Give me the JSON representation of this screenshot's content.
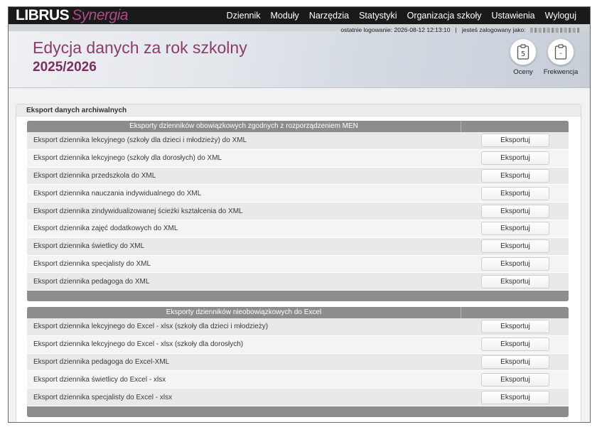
{
  "logo": {
    "part1": "LIBRUS",
    "part2": "Synergia"
  },
  "nav": [
    "Dziennik",
    "Moduły",
    "Narzędzia",
    "Statystyki",
    "Organizacja szkoły",
    "Ustawienia",
    "Wyloguj"
  ],
  "header": {
    "last_login": "ostatnie logowanie: 2026-08-12 12:13:10",
    "separator": "|",
    "logged_as": "jesteś zalogowany jako:",
    "title": "Edycja danych za rok szkolny",
    "year": "2025/2026"
  },
  "quick": [
    {
      "label": "Oceny",
      "icon": "grade-clipboard-icon",
      "glyph": "5"
    },
    {
      "label": "Frekwencja",
      "icon": "attendance-clipboard-icon",
      "glyph": "-"
    }
  ],
  "panel_title": "Eksport danych archiwalnych",
  "tables": [
    {
      "header": "Eksporty dzienników obowiązkowych zgodnych z rozporządzeniem MEN",
      "rows": [
        "Eksport dziennika lekcyjnego (szkoły dla dzieci i młodzieży) do XML",
        "Eksport dziennika lekcyjnego (szkoły dla dorosłych) do XML",
        "Eksport dziennika przedszkola do XML",
        "Eksport dziennika nauczania indywidualnego do XML",
        "Eksport dziennika zindywidualizowanej ścieżki kształcenia do XML",
        "Eksport dziennika zajęć dodatkowych do XML",
        "Eksport dziennika świetlicy do XML",
        "Eksport dziennika specjalisty do XML",
        "Eksport dziennika pedagoga do XML"
      ]
    },
    {
      "header": "Eksporty dzienników nieobowiązkowych do Excel",
      "rows": [
        "Eksport dziennika lekcyjnego do Excel - xlsx (szkoły dla dzieci i młodzieży)",
        "Eksport dziennika lekcyjnego do Excel - xlsx (szkoły dla dorosłych)",
        "Eksport dziennika pedagoga do Excel-XML",
        "Eksport dziennika świetlicy do Excel - xlsx",
        "Eksport dziennika specjalisty do Excel - xlsx"
      ]
    }
  ],
  "export_label": "Eksportuj"
}
